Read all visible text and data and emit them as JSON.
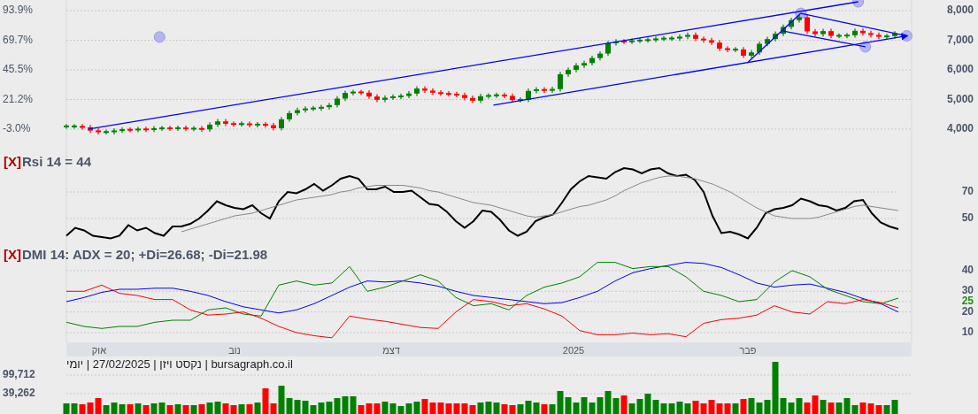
{
  "price_chart": {
    "left_axis_labels": [
      "93.9%",
      "69.7%",
      "45.5%",
      "21.2%",
      "-3.0%"
    ],
    "chart_data": {
      "type": "candlestick",
      "grid": true,
      "ylim": [
        3430,
        8360
      ],
      "yticks": [
        {
          "value": 8000,
          "label": "8,000"
        },
        {
          "value": 7000,
          "label": "7,000"
        },
        {
          "value": 6000,
          "label": "6,000"
        },
        {
          "value": 5000,
          "label": "5,000"
        },
        {
          "value": 4000,
          "label": "4,000"
        }
      ],
      "ohlc": [
        [
          4090,
          4170,
          4010,
          4090
        ],
        [
          4090,
          4170,
          4010,
          4090
        ],
        [
          4090,
          4170,
          3980,
          4060
        ],
        [
          4060,
          4140,
          3870,
          3950
        ],
        [
          3950,
          4030,
          3820,
          3900
        ],
        [
          3900,
          3980,
          3820,
          3900
        ],
        [
          3900,
          4030,
          3820,
          3950
        ],
        [
          3950,
          4060,
          3870,
          3980
        ],
        [
          3980,
          4060,
          3890,
          3970
        ],
        [
          3970,
          4080,
          3890,
          4000
        ],
        [
          4000,
          4080,
          3900,
          3980
        ],
        [
          3980,
          4100,
          3900,
          4020
        ],
        [
          4020,
          4110,
          3940,
          4030
        ],
        [
          4030,
          4110,
          3940,
          4020
        ],
        [
          4020,
          4120,
          3940,
          4040
        ],
        [
          4040,
          4120,
          3930,
          4010
        ],
        [
          4010,
          4100,
          3930,
          4020
        ],
        [
          4020,
          4100,
          3910,
          3990
        ],
        [
          3990,
          4230,
          3910,
          4150
        ],
        [
          4150,
          4340,
          4070,
          4260
        ],
        [
          4260,
          4340,
          4100,
          4180
        ],
        [
          4180,
          4260,
          4080,
          4160
        ],
        [
          4160,
          4260,
          4080,
          4180
        ],
        [
          4180,
          4260,
          4060,
          4140
        ],
        [
          4140,
          4240,
          4060,
          4160
        ],
        [
          4160,
          4240,
          4050,
          4130
        ],
        [
          4130,
          4210,
          3950,
          4030
        ],
        [
          4030,
          4410,
          3950,
          4330
        ],
        [
          4330,
          4620,
          4250,
          4540
        ],
        [
          4540,
          4720,
          4460,
          4640
        ],
        [
          4640,
          4770,
          4560,
          4690
        ],
        [
          4690,
          4780,
          4610,
          4700
        ],
        [
          4700,
          4820,
          4620,
          4740
        ],
        [
          4740,
          4890,
          4660,
          4810
        ],
        [
          4810,
          5110,
          4730,
          5030
        ],
        [
          5030,
          5300,
          4950,
          5220
        ],
        [
          5220,
          5330,
          5140,
          5250
        ],
        [
          5250,
          5330,
          5150,
          5230
        ],
        [
          5230,
          5310,
          5020,
          5100
        ],
        [
          5100,
          5180,
          4910,
          4990
        ],
        [
          4990,
          5140,
          4910,
          5060
        ],
        [
          5060,
          5170,
          4980,
          5090
        ],
        [
          5090,
          5200,
          5010,
          5120
        ],
        [
          5120,
          5280,
          5040,
          5200
        ],
        [
          5200,
          5450,
          5120,
          5370
        ],
        [
          5370,
          5450,
          5220,
          5300
        ],
        [
          5300,
          5380,
          5150,
          5230
        ],
        [
          5230,
          5310,
          5120,
          5200
        ],
        [
          5200,
          5280,
          5100,
          5180
        ],
        [
          5180,
          5260,
          5070,
          5150
        ],
        [
          5150,
          5230,
          4970,
          5050
        ],
        [
          5050,
          5130,
          4880,
          4960
        ],
        [
          4960,
          5190,
          4880,
          5110
        ],
        [
          5110,
          5210,
          5030,
          5130
        ],
        [
          5130,
          5230,
          5050,
          5150
        ],
        [
          5150,
          5230,
          5040,
          5120
        ],
        [
          5120,
          5200,
          4900,
          4980
        ],
        [
          4980,
          5070,
          4900,
          4990
        ],
        [
          4990,
          5370,
          4910,
          5290
        ],
        [
          5290,
          5420,
          5210,
          5340
        ],
        [
          5340,
          5420,
          5220,
          5300
        ],
        [
          5300,
          5430,
          5220,
          5350
        ],
        [
          5350,
          5930,
          5270,
          5850
        ],
        [
          5850,
          6080,
          5770,
          6000
        ],
        [
          6000,
          6230,
          5920,
          6150
        ],
        [
          6150,
          6310,
          6070,
          6230
        ],
        [
          6230,
          6480,
          6150,
          6400
        ],
        [
          6400,
          6630,
          6320,
          6550
        ],
        [
          6550,
          6980,
          6470,
          6900
        ],
        [
          6900,
          7040,
          6820,
          6960
        ],
        [
          6960,
          7040,
          6870,
          6950
        ],
        [
          6950,
          7060,
          6870,
          6980
        ],
        [
          6980,
          7080,
          6900,
          7000
        ],
        [
          7000,
          7090,
          6920,
          7010
        ],
        [
          7010,
          7130,
          6930,
          7050
        ],
        [
          7050,
          7140,
          6970,
          7060
        ],
        [
          7060,
          7140,
          6980,
          7060
        ],
        [
          7060,
          7200,
          6980,
          7120
        ],
        [
          7120,
          7260,
          7040,
          7180
        ],
        [
          7180,
          7260,
          6970,
          7050
        ],
        [
          7050,
          7130,
          6920,
          7000
        ],
        [
          7000,
          7080,
          6840,
          6920
        ],
        [
          6920,
          7000,
          6640,
          6720
        ],
        [
          6720,
          6800,
          6600,
          6680
        ],
        [
          6680,
          6770,
          6600,
          6690
        ],
        [
          6690,
          6770,
          6400,
          6480
        ],
        [
          6480,
          6670,
          6400,
          6590
        ],
        [
          6590,
          6960,
          6510,
          6880
        ],
        [
          6880,
          7120,
          6800,
          7040
        ],
        [
          7040,
          7300,
          6960,
          7220
        ],
        [
          7220,
          7530,
          7140,
          7450
        ],
        [
          7450,
          7760,
          7370,
          7680
        ],
        [
          7680,
          7860,
          7600,
          7780
        ],
        [
          7780,
          7860,
          7220,
          7300
        ],
        [
          7300,
          7380,
          7130,
          7210
        ],
        [
          7210,
          7390,
          7130,
          7310
        ],
        [
          7310,
          7390,
          7070,
          7150
        ],
        [
          7150,
          7230,
          7070,
          7150
        ],
        [
          7150,
          7250,
          7070,
          7170
        ],
        [
          7170,
          7400,
          7090,
          7320
        ],
        [
          7320,
          7400,
          7160,
          7240
        ],
        [
          7240,
          7320,
          7100,
          7180
        ],
        [
          7180,
          7260,
          7040,
          7120
        ],
        [
          7120,
          7220,
          7040,
          7140
        ],
        [
          7140,
          7310,
          7060,
          7230
        ]
      ]
    }
  },
  "rsi_panel": {
    "close_label": "[X]",
    "title": "Rsi 14 = 44",
    "chart_data": {
      "type": "line",
      "grid": true,
      "ylim": [
        28,
        104.7
      ],
      "yticks": [
        70,
        50
      ],
      "series": [
        {
          "color": "#000000",
          "values": [
            37,
            43,
            41,
            37,
            36,
            35,
            37,
            45,
            41,
            43,
            39,
            37,
            44,
            44,
            46,
            50,
            56,
            63,
            60,
            58,
            57,
            60,
            54,
            50,
            63,
            70,
            69,
            72,
            76,
            71,
            75,
            80,
            82,
            80,
            72,
            72,
            74,
            70,
            70,
            71,
            66,
            61,
            60,
            55,
            48,
            43,
            48,
            56,
            55,
            49,
            41,
            37,
            40,
            48,
            51,
            53,
            62,
            72,
            78,
            82,
            81,
            80,
            85,
            88,
            87,
            84,
            87,
            88,
            84,
            82,
            83,
            79,
            70,
            52,
            39,
            40,
            38,
            35,
            43,
            54,
            57,
            58,
            60,
            65,
            63,
            60,
            59,
            56,
            58,
            63,
            64,
            54,
            47,
            44,
            42
          ]
        },
        {
          "color": "#888888",
          "values": [
            null,
            null,
            null,
            null,
            null,
            null,
            null,
            null,
            null,
            null,
            null,
            null,
            null,
            40,
            42,
            44,
            46,
            48,
            50,
            52,
            53,
            54,
            56,
            58,
            60,
            62,
            64,
            65,
            66,
            67,
            68,
            70,
            71,
            73,
            74,
            75,
            75,
            75,
            75,
            74,
            73,
            71,
            70,
            68,
            66,
            64,
            62,
            61,
            60,
            58,
            56,
            54,
            52,
            51,
            52,
            53,
            55,
            57,
            59,
            60,
            62,
            64,
            67,
            71,
            74,
            77,
            79,
            81,
            82,
            82,
            81,
            80,
            78,
            76,
            73,
            70,
            66,
            62,
            58,
            55,
            52,
            51,
            50,
            50,
            50,
            51,
            53,
            55,
            57,
            59,
            60,
            59,
            58,
            57,
            56
          ]
        }
      ]
    }
  },
  "dmi_panel": {
    "close_label": "[X]",
    "title": "DMI 14: ADX = 20; +Di=26.68; -Di=21.98",
    "chart_data": {
      "type": "line",
      "grid": true,
      "ylim": [
        5.3,
        51.1
      ],
      "yticks": [
        40,
        30,
        25,
        20,
        10
      ],
      "series": [
        {
          "color": "#0000ff",
          "values": [
            25,
            27,
            29.5,
            31,
            31,
            31.5,
            31.5,
            30,
            28,
            25,
            22.5,
            21,
            19.5,
            21,
            24,
            28,
            32,
            35,
            34.5,
            35,
            34,
            32.5,
            30,
            28,
            27,
            26,
            25,
            24,
            24.5,
            27,
            30,
            35,
            39,
            41,
            42.5,
            44,
            43.5,
            41.5,
            38,
            34,
            32,
            33,
            33.5,
            31.5,
            29.5,
            26.5,
            24,
            20
          ]
        },
        {
          "color": "#008000",
          "values": [
            15,
            13,
            12,
            13,
            13,
            15,
            16,
            16,
            21,
            22,
            19,
            18,
            33,
            35,
            33,
            34,
            42,
            30,
            32,
            35,
            38,
            35,
            27,
            23,
            24,
            21,
            28,
            32,
            34,
            37,
            44,
            44,
            41,
            42,
            42,
            37,
            30,
            28,
            25,
            26,
            34.5,
            40,
            37,
            31,
            28,
            25,
            24,
            26.7
          ]
        },
        {
          "color": "#ff0000",
          "values": [
            30,
            30,
            33,
            29,
            28,
            26,
            26,
            21,
            18.5,
            19,
            20,
            17,
            13,
            10,
            8.5,
            7.5,
            18,
            16.5,
            15.5,
            14,
            12.5,
            12,
            20,
            26,
            25,
            23,
            24,
            21.5,
            18,
            11,
            9,
            9,
            9.8,
            9,
            9.5,
            8,
            14.5,
            16.3,
            17,
            18.5,
            23,
            20,
            19,
            25,
            24,
            26,
            24.5,
            22
          ]
        }
      ]
    }
  },
  "x_axis": {
    "labels": [
      "פבר",
      "2025",
      "דצמ",
      "נוב",
      "אוק"
    ]
  },
  "footer": "bursagraph.co.il | נקסט ויזן | 27/02/2025 | יומי",
  "volume_panel": {
    "axis_labels": [
      "99,712",
      "39,262"
    ]
  }
}
